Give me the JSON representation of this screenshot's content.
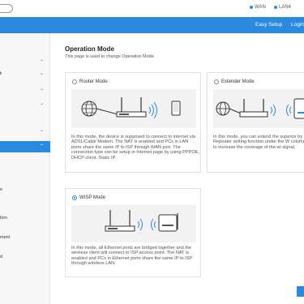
{
  "header": {
    "status": [
      {
        "label": "WAN"
      },
      {
        "label": "LAN4"
      }
    ]
  },
  "navbar": {
    "links": [
      {
        "label": "Easy Setup"
      },
      {
        "label": "Login"
      }
    ]
  },
  "sidebar": {
    "items": [
      {
        "label": "",
        "chevron": "⌄"
      },
      {
        "label": "t",
        "chevron": "⌄"
      },
      {
        "label": "",
        "chevron": "⌄"
      },
      {
        "label": "",
        "chevron": "⌄"
      },
      {
        "label": "",
        "chevron": "⌄"
      },
      {
        "label": "",
        "chevron": "⌃"
      }
    ],
    "sub_items": [
      "e",
      "tion",
      "ment",
      "d"
    ]
  },
  "main": {
    "title": "Operation Mode",
    "description": "This page is used to change Operation Mode.",
    "modes": [
      {
        "label": "Router Mode",
        "selected": false,
        "description": "In this mode, the device is supposed to connect to internet via ADSL/Cable Modem. The NAT is enabled and PCs in LAN ports share the same IP to ISP through WAN port. The connection type can be setup in Internet page by using PPPOE, DHCP client, Static IP."
      },
      {
        "label": "Extender Mode",
        "selected": false,
        "description": "In this mode, you can extend the superior by Repeater setting function under the W column to increase the coverage of the wi signal."
      },
      {
        "label": "WISP Mode",
        "selected": true,
        "description": "In this mode, all Ethernet ports are bridged together and the wireless client will connect to ISP access point. The NAT is enabled and PCs in Ethernet ports share the same IP to ISP through wireless LAN."
      }
    ]
  },
  "colors": {
    "accent": "#2a8ae0",
    "sidebar_bg": "#f7f7f7",
    "illustration_bg": "#f2f2f2"
  }
}
